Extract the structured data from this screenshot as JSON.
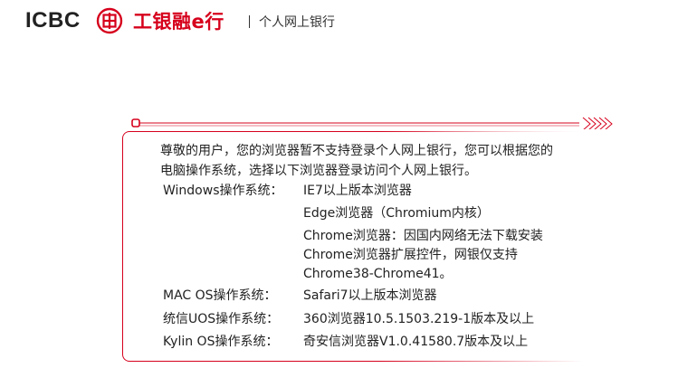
{
  "header": {
    "logo_text": "ICBC",
    "logo_cn_a": "工银融",
    "logo_cn_b": "e行",
    "site_title": "个人网上银行"
  },
  "colors": {
    "brand_red": "#d6001c",
    "text": "#222222"
  },
  "notice": {
    "intro_line1": "尊敬的用户，您的浏览器暂不支持登录个人网上银行，您可以根据您的",
    "intro_line2": "电脑操作系统，选择以下浏览器登录访问个人网上银行。",
    "windows_label": "Windows操作系统：",
    "windows_values": [
      "IE7以上版本浏览器",
      "Edge浏览器（Chromium内核）",
      "Chrome浏览器：因国内网络无法下载安装",
      "Chrome浏览器扩展控件，网银仅支持",
      "Chrome38-Chrome41。"
    ],
    "mac_label": "MAC OS操作系统：",
    "mac_value": "Safari7以上版本浏览器",
    "uos_label": "统信UOS操作系统：",
    "uos_value": "360浏览器10.5.1503.219-1版本及以上",
    "kylin_label": "Kylin OS操作系统：",
    "kylin_value": "奇安信浏览器V1.0.41580.7版本及以上"
  },
  "icons": {
    "logo_seal": "icbc-seal-icon",
    "rule_arrows": "chevron-right-icon"
  }
}
